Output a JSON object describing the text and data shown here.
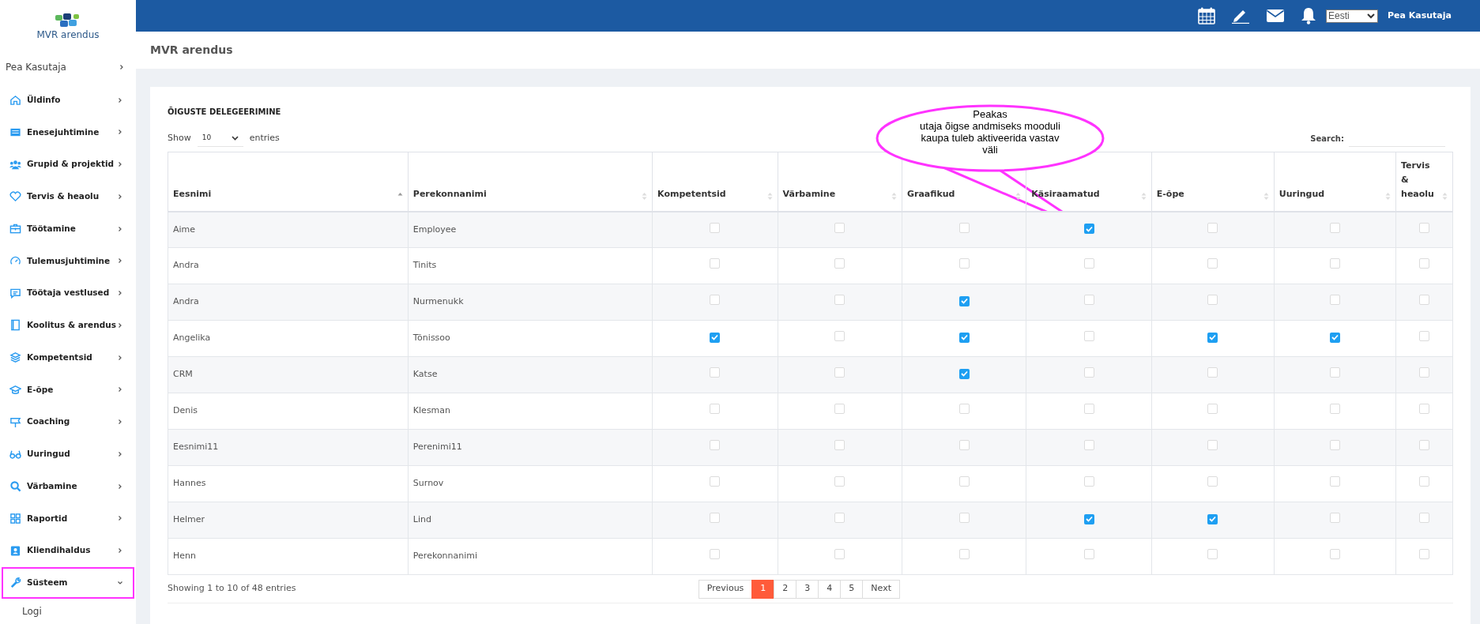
{
  "sidebar": {
    "logo_text": "MVR arendus",
    "user": {
      "label": "Pea Kasutaja"
    },
    "items": [
      {
        "label": "Üldinfo",
        "expanded": false,
        "highlighted": false
      },
      {
        "label": "Enesejuhtimine",
        "expanded": false,
        "highlighted": false
      },
      {
        "label": "Grupid & projektid",
        "expanded": false,
        "highlighted": false
      },
      {
        "label": "Tervis & heaolu",
        "expanded": false,
        "highlighted": false
      },
      {
        "label": "Töötamine",
        "expanded": false,
        "highlighted": false
      },
      {
        "label": "Tulemusjuhtimine",
        "expanded": false,
        "highlighted": false
      },
      {
        "label": "Töötaja vestlused",
        "expanded": false,
        "highlighted": false
      },
      {
        "label": "Koolitus & arendus",
        "expanded": false,
        "highlighted": false
      },
      {
        "label": "Kompetentsid",
        "expanded": false,
        "highlighted": false
      },
      {
        "label": "E-õpe",
        "expanded": false,
        "highlighted": false
      },
      {
        "label": "Coaching",
        "expanded": false,
        "highlighted": false
      },
      {
        "label": "Uuringud",
        "expanded": false,
        "highlighted": false
      },
      {
        "label": "Värbamine",
        "expanded": false,
        "highlighted": false
      },
      {
        "label": "Raportid",
        "expanded": false,
        "highlighted": false
      },
      {
        "label": "Kliendihaldus",
        "expanded": false,
        "highlighted": false
      },
      {
        "label": "Süsteem",
        "expanded": true,
        "highlighted": true,
        "children": [
          {
            "label": "Logi"
          }
        ]
      }
    ]
  },
  "topbar": {
    "language": "Eesti",
    "user": "Pea Kasutaja"
  },
  "page_title": "MVR arendus",
  "card": {
    "title": "ÕIGUSTE DELEGEERIMINE",
    "show_label": "Show",
    "page_size": "10",
    "entries_label": "entries",
    "search_label": "Search:",
    "callout": "Peakas\nutaja õigse andmiseks mooduli\nkaupa tuleb aktiveerida vastav\nväli",
    "table": {
      "columns": [
        {
          "label": "Eesnimi",
          "sorted": true
        },
        {
          "label": "Perekonnanimi",
          "sorted": false
        },
        {
          "label": "Kompetentsid",
          "sorted": false
        },
        {
          "label": "Värbamine",
          "sorted": false
        },
        {
          "label": "Graafikud",
          "sorted": false
        },
        {
          "label": "Käsiraamatud",
          "sorted": false
        },
        {
          "label": "E-õpe",
          "sorted": false
        },
        {
          "label": "Uuringud",
          "sorted": false
        },
        {
          "label": "Tervis & heaolu",
          "sorted": false
        }
      ],
      "rows": [
        {
          "first": "Aime",
          "last": "Employee",
          "checks": [
            false,
            false,
            false,
            true,
            false,
            false,
            false
          ]
        },
        {
          "first": "Andra",
          "last": "Tinits",
          "checks": [
            false,
            false,
            false,
            false,
            false,
            false,
            false
          ]
        },
        {
          "first": "Andra",
          "last": "Nurmenukk",
          "checks": [
            false,
            false,
            true,
            false,
            false,
            false,
            false
          ]
        },
        {
          "first": "Angelika",
          "last": "Tõnissoo",
          "checks": [
            true,
            false,
            true,
            false,
            true,
            true,
            false
          ]
        },
        {
          "first": "CRM",
          "last": "Katse",
          "checks": [
            false,
            false,
            true,
            false,
            false,
            false,
            false
          ]
        },
        {
          "first": "Denis",
          "last": "Klesman",
          "checks": [
            false,
            false,
            false,
            false,
            false,
            false,
            false
          ]
        },
        {
          "first": "Eesnimi11",
          "last": "Perenimi11",
          "checks": [
            false,
            false,
            false,
            false,
            false,
            false,
            false
          ]
        },
        {
          "first": "Hannes",
          "last": "Surnov",
          "checks": [
            false,
            false,
            false,
            false,
            false,
            false,
            false
          ]
        },
        {
          "first": "Helmer",
          "last": "Lind",
          "checks": [
            false,
            false,
            false,
            true,
            true,
            false,
            false
          ]
        },
        {
          "first": "Henn",
          "last": "Perekonnanimi",
          "checks": [
            false,
            false,
            false,
            false,
            false,
            false,
            false
          ]
        }
      ]
    },
    "info": "Showing 1 to 10 of 48 entries",
    "pagination": [
      {
        "label": "Previous",
        "selected": false
      },
      {
        "label": "1",
        "selected": true
      },
      {
        "label": "2",
        "selected": false
      },
      {
        "label": "3",
        "selected": false
      },
      {
        "label": "4",
        "selected": false
      },
      {
        "label": "5",
        "selected": false
      },
      {
        "label": "Next",
        "selected": false
      }
    ]
  }
}
